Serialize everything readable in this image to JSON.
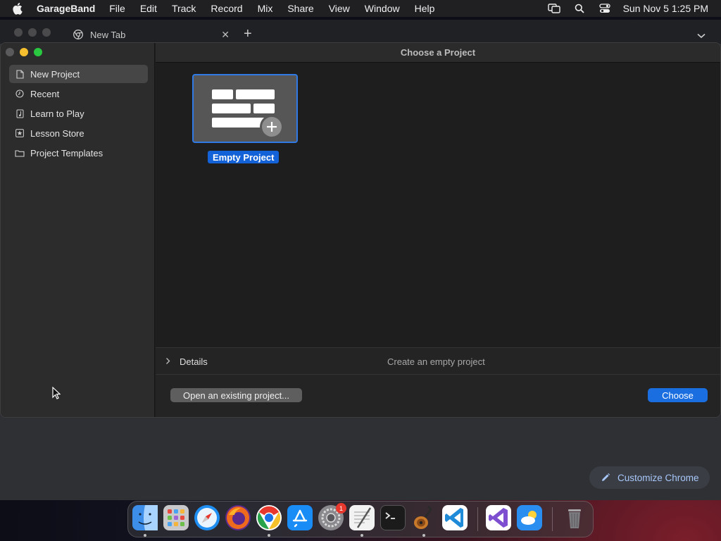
{
  "menubar": {
    "app_name": "GarageBand",
    "menus": [
      "File",
      "Edit",
      "Track",
      "Record",
      "Mix",
      "Share",
      "View",
      "Window",
      "Help"
    ],
    "clock": "Sun Nov 5  1:25 PM",
    "status_icons": [
      "screen-mirroring-icon",
      "spotlight-search-icon",
      "control-center-icon"
    ]
  },
  "browser": {
    "tab_title": "New Tab",
    "customize_label": "Customize Chrome"
  },
  "dialog": {
    "title": "Choose a Project",
    "sidebar": [
      {
        "label": "New Project",
        "icon": "document-icon",
        "selected": true
      },
      {
        "label": "Recent",
        "icon": "clock-icon",
        "selected": false
      },
      {
        "label": "Learn to Play",
        "icon": "music-note-icon",
        "selected": false
      },
      {
        "label": "Lesson Store",
        "icon": "star-icon",
        "selected": false
      },
      {
        "label": "Project Templates",
        "icon": "folder-icon",
        "selected": false
      }
    ],
    "template": {
      "label": "Empty Project"
    },
    "details_label": "Details",
    "details_description": "Create an empty project",
    "open_existing_label": "Open an existing project...",
    "choose_label": "Choose"
  },
  "dock": {
    "apps": [
      {
        "name": "finder-icon",
        "color": "#3d8ee8"
      },
      {
        "name": "launchpad-icon",
        "color": "#c9c9cc"
      },
      {
        "name": "safari-icon",
        "color": "#1e8ef2"
      },
      {
        "name": "firefox-icon",
        "color": "#f06a1d"
      },
      {
        "name": "chrome-icon",
        "color": "#ffffff"
      },
      {
        "name": "app-store-icon",
        "color": "#1a8cf5"
      },
      {
        "name": "system-settings-icon",
        "color": "#8a8a8e"
      },
      {
        "name": "textedit-icon",
        "color": "#f2f2f2"
      },
      {
        "name": "terminal-icon",
        "color": "#1b1b1b"
      },
      {
        "name": "garageband-icon",
        "color": "#6a4a2e"
      },
      {
        "name": "vscode-icon",
        "color": "#ffffff"
      },
      {
        "name": "visual-studio-icon",
        "color": "#ffffff"
      },
      {
        "name": "weather-icon",
        "color": "#2a8ef0"
      },
      {
        "name": "trash-icon",
        "color": "#6e6e72"
      }
    ],
    "settings_badge": "1"
  },
  "colors": {
    "accent": "#1a6ee0",
    "selection": "#1462d8"
  }
}
